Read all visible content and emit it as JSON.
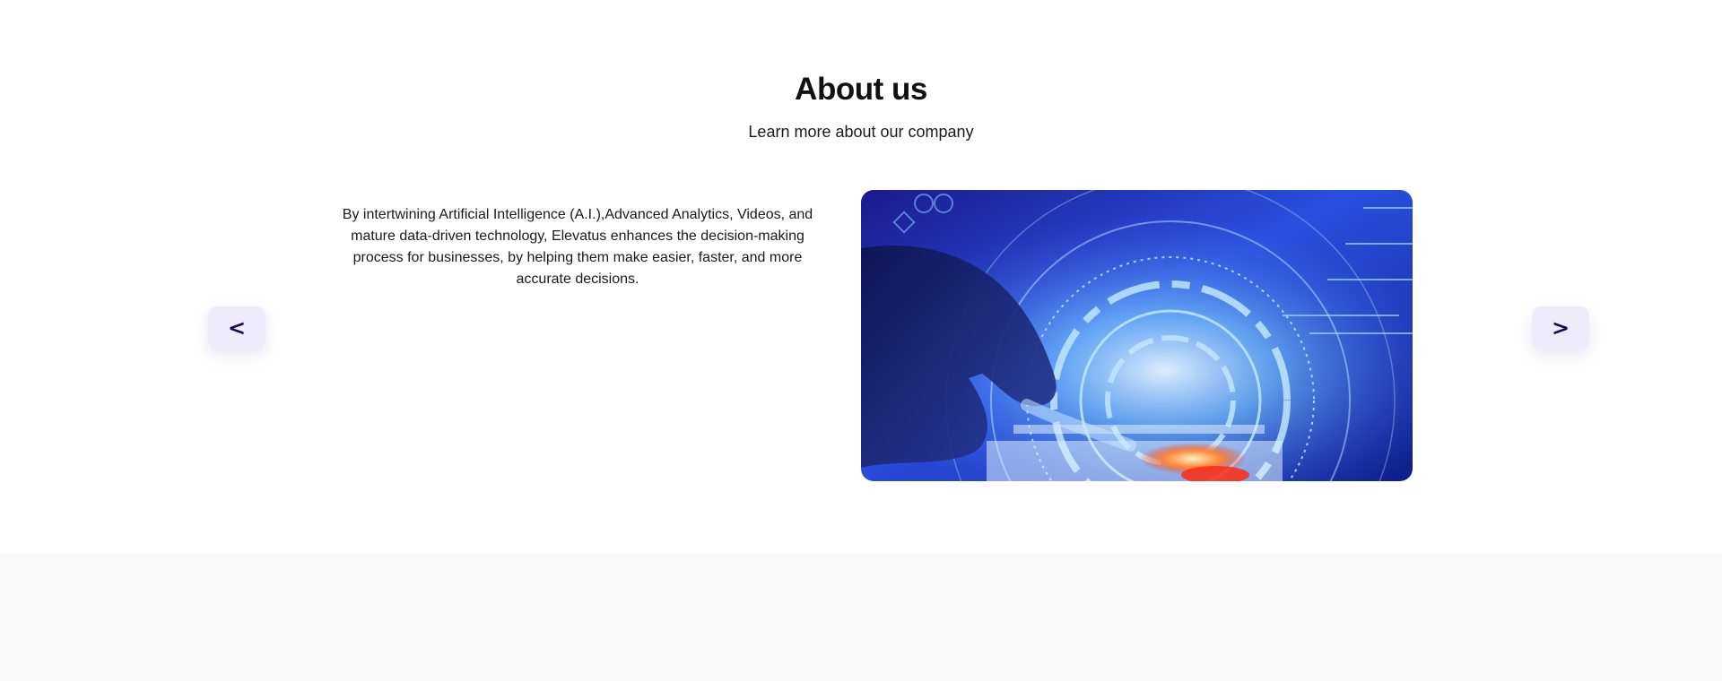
{
  "about": {
    "title": "About us",
    "subtitle": "Learn more about our company",
    "description": "By intertwining Artificial Intelligence (A.I.),Advanced Analytics, Videos, and mature data-driven technology, Elevatus enhances the decision-making process for businesses, by helping them make easier, faster, and more accurate decisions."
  },
  "carousel": {
    "prev_label": "<",
    "next_label": ">",
    "image_subject": "hand-touching-holographic-tech-interface"
  },
  "colors": {
    "nav_button_bg": "#eeecfb",
    "nav_button_text": "#1e0a4a",
    "footer_band_bg": "#f9f9f9"
  }
}
